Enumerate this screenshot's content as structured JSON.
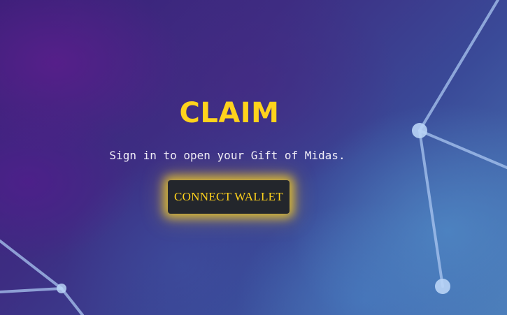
{
  "hero": {
    "title": "CLAIM",
    "subtitle": "Sign in to open your Gift of Midas.",
    "button_label": "CONNECT WALLET"
  },
  "colors": {
    "accent": "#ffd21c",
    "button_bg": "#23262c",
    "text": "#f1eef8",
    "network_lines": "#a9c6f0"
  }
}
